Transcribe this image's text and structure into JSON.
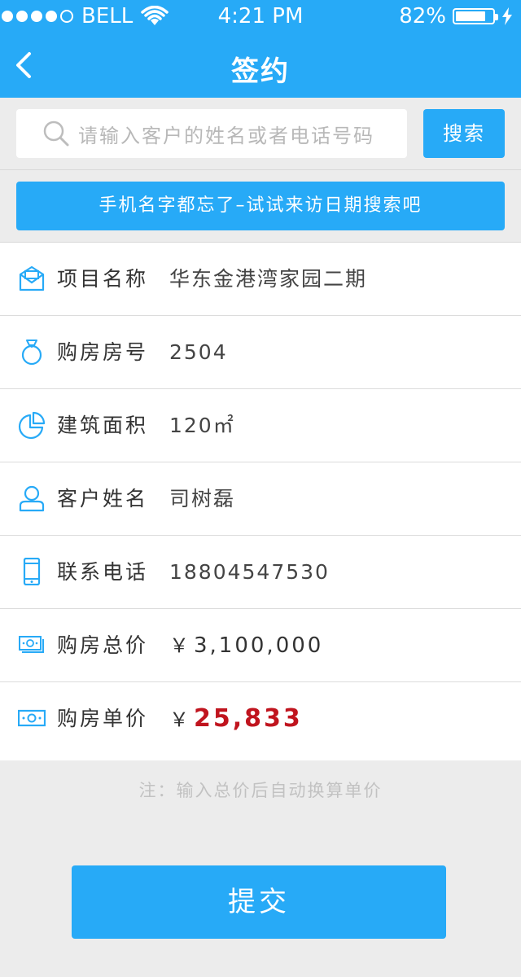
{
  "status_bar": {
    "carrier": "BELL",
    "time": "4:21 PM",
    "battery_percent": "82%",
    "battery_level": 0.82,
    "signal_dots": [
      true,
      true,
      true,
      true,
      false
    ]
  },
  "nav": {
    "title": "签约",
    "back_icon": "chevron-left-icon"
  },
  "search": {
    "placeholder": "请输入客户的姓名或者电话号码",
    "button_label": "搜索"
  },
  "date_search_label": "手机名字都忘了–试试来访日期搜索吧",
  "form": {
    "rows": [
      {
        "icon": "envelope-icon",
        "label": "项目名称",
        "value": "华东金港湾家园二期"
      },
      {
        "icon": "ring-icon",
        "label": "购房房号",
        "value": "2504"
      },
      {
        "icon": "pie-chart-icon",
        "label": "建筑面积",
        "value": "120㎡"
      },
      {
        "icon": "user-icon",
        "label": "客户姓名",
        "value": "司树磊"
      },
      {
        "icon": "phone-icon",
        "label": "联系电话",
        "value": "18804547530"
      },
      {
        "icon": "banknote-stack-icon",
        "label": "购房总价",
        "currency": "￥",
        "value": "3,100,000"
      },
      {
        "icon": "banknote-icon",
        "label": "购房单价",
        "currency": "￥",
        "value": "25,833"
      }
    ]
  },
  "note": "注：输入总价后自动换算单价",
  "submit_label": "提交",
  "colors": {
    "primary": "#27aaf7",
    "background": "#ececec",
    "price_red": "#c0141e"
  }
}
